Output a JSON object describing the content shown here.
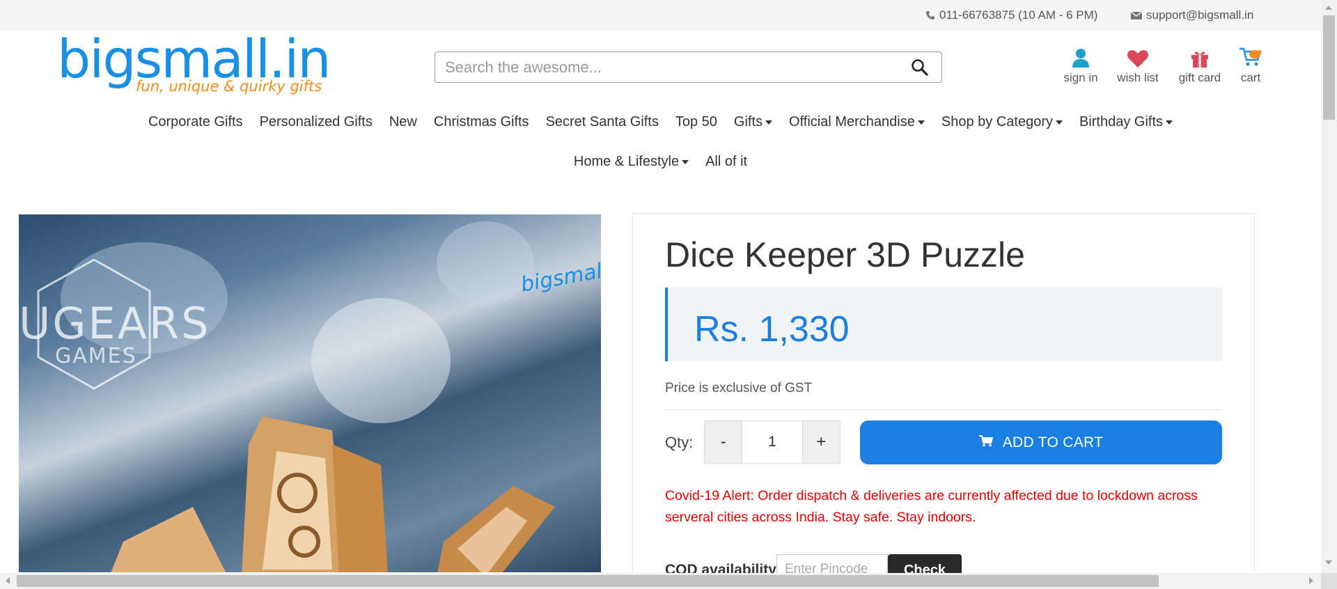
{
  "topbar": {
    "phone": "011-66763875 (10 AM - 6 PM)",
    "email": "support@bigsmall.in"
  },
  "logo": {
    "brand": "bigsmall.in",
    "tagline": "fun, unique & quirky gifts"
  },
  "search": {
    "placeholder": "Search the awesome..."
  },
  "header_icons": {
    "signin": "sign in",
    "wishlist": "wish list",
    "giftcard": "gift card",
    "cart": "cart"
  },
  "nav": {
    "row1": [
      {
        "label": "Corporate Gifts",
        "dropdown": false
      },
      {
        "label": "Personalized Gifts",
        "dropdown": false
      },
      {
        "label": "New",
        "dropdown": false
      },
      {
        "label": "Christmas Gifts",
        "dropdown": false
      },
      {
        "label": "Secret Santa Gifts",
        "dropdown": false
      },
      {
        "label": "Top 50",
        "dropdown": false
      },
      {
        "label": "Gifts",
        "dropdown": true
      },
      {
        "label": "Official Merchandise",
        "dropdown": true
      },
      {
        "label": "Shop by Category",
        "dropdown": true
      },
      {
        "label": "Birthday Gifts",
        "dropdown": true
      }
    ],
    "row2": [
      {
        "label": "Home & Lifestyle",
        "dropdown": true
      },
      {
        "label": "All of it",
        "dropdown": false
      }
    ]
  },
  "image": {
    "brand_text": "UGEARS",
    "brand_sub": "GAMES",
    "watermark": "bigsmall.in"
  },
  "product": {
    "title": "Dice Keeper 3D Puzzle",
    "price": "Rs. 1,330",
    "gst_note": "Price is exclusive of GST",
    "qty_label": "Qty:",
    "qty_minus": "-",
    "qty_value": "1",
    "qty_plus": "+",
    "add_to_cart": "ADD TO CART",
    "alert": "Covid-19 Alert: Order dispatch & deliveries are currently affected due to lockdown across serveral cities across India. Stay safe. Stay indoors.",
    "cod_label": "COD availability",
    "pincode_placeholder": "Enter Pincode",
    "check_button": "Check"
  },
  "colors": {
    "accent": "#1a7fe0",
    "alert": "#e60000",
    "logo_blue": "#1a8fe6",
    "logo_orange": "#f28c1a"
  }
}
